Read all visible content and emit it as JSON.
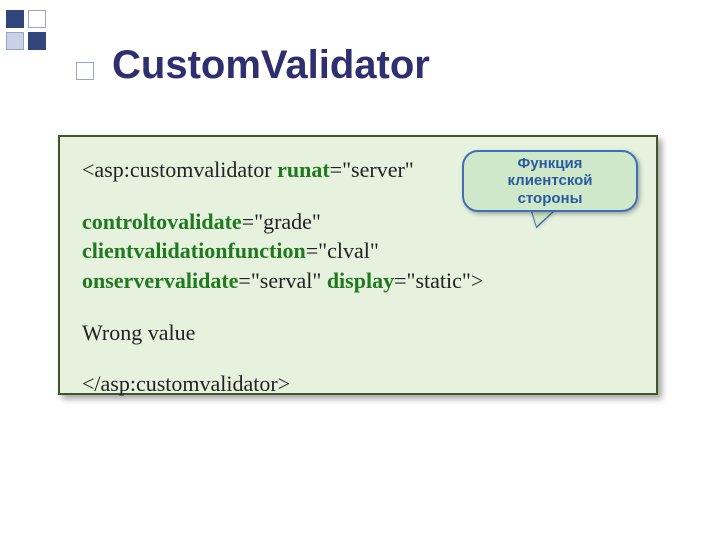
{
  "title": "CustomValidator",
  "callout": {
    "line1": "Функция",
    "line2": "клиентской",
    "line3": "стороны"
  },
  "code": {
    "open_tag_prefix": "<asp:customvalidator ",
    "attr_runat": "runat",
    "val_runat": "=\"server\"",
    "attr_controltovalidate": "controltovalidate",
    "val_controltovalidate": "=\"grade\"",
    "attr_clientvalidationfunction": "clientvalidationfunction",
    "val_clientvalidationfunction": "=\"clval\"",
    "attr_onservervalidate": "onservervalidate",
    "val_onservervalidate": "=\"serval\" ",
    "attr_display": "display",
    "val_display": "=\"static\">",
    "inner_text": "Wrong value",
    "close_tag": "</asp:customvalidator>"
  }
}
